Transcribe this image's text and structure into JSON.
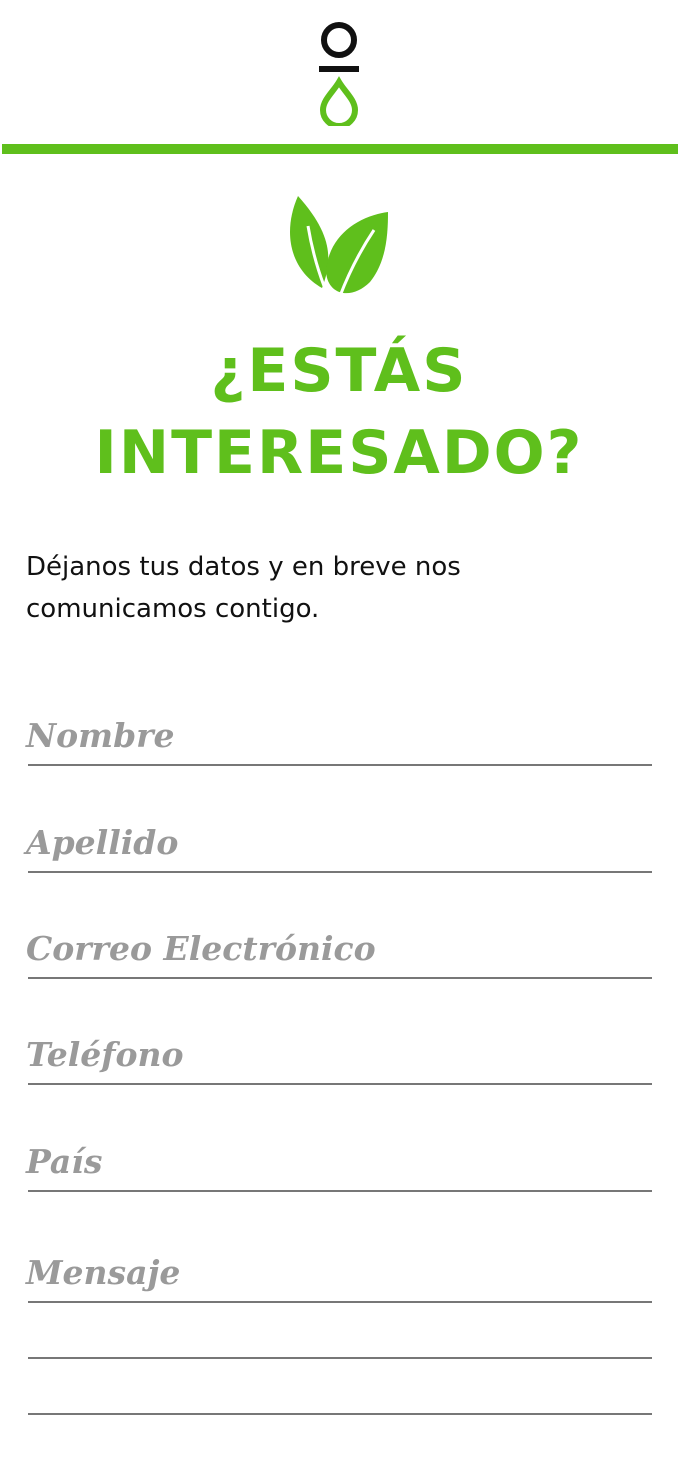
{
  "colors": {
    "accent": "#5fbf1c",
    "logo_dark": "#111111",
    "placeholder": "#9a9a9a",
    "rule": "#777777"
  },
  "header": {
    "logo_icon": "drop-logo-icon"
  },
  "hero": {
    "icon": "leaves-icon",
    "title_line1": "¿ESTÁS",
    "title_line2": "INTERESADO?",
    "intro_line1": "Déjanos tus datos y en breve nos",
    "intro_line2": "comunicamos contigo."
  },
  "form": {
    "nombre_placeholder": "Nombre",
    "apellido_placeholder": "Apellido",
    "correo_placeholder": "Correo Electrónico",
    "telefono_placeholder": "Teléfono",
    "pais_placeholder": "País",
    "mensaje_placeholder": "Mensaje"
  }
}
